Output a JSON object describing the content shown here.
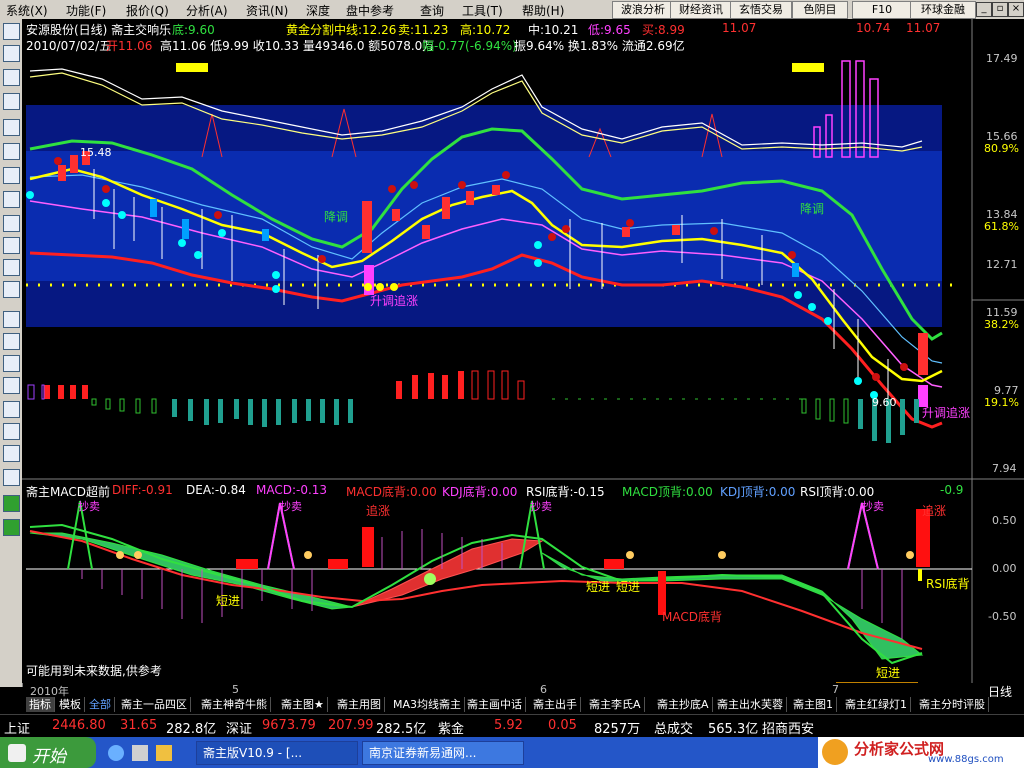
{
  "menubar": {
    "items": [
      "系统(X)",
      "功能(F)",
      "报价(Q)",
      "分析(A)",
      "资讯(N)",
      "深度",
      "盘中参考",
      "查询",
      "工具(T)",
      "帮助(H)"
    ],
    "right_buttons": [
      "波浪分析",
      "财经资讯",
      "玄悟交易",
      "色阴目",
      "F10",
      "环球金融"
    ]
  },
  "header": {
    "stock": "安源股份(日线) 斋主交响乐",
    "bottom": "底:9.60",
    "fib": "黄金分割中线:12.26",
    "sell": "卖:11.23",
    "high": "高:10.72",
    "mid": "中:10.21",
    "low": "低:9.65",
    "buy": "买:8.99",
    "m1": "11.07",
    "m2": "10.74",
    "m3": "11.07",
    "line2_date": "2010/07/02/五",
    "line2_open": "开11.06",
    "line2_rest": "高11.06 低9.99 收10.33 量49346.0 额5078.0万",
    "line2_change": "幅-0.77(-6.94%)",
    "line2_tail": "振9.64% 换1.83% 流通2.69亿"
  },
  "price_axis": {
    "ticks": [
      "17.49",
      "15.66",
      "80.9%",
      "13.84",
      "61.8%",
      "12.71",
      "11.59",
      "38.2%",
      "9.77",
      "19.1%",
      "7.94"
    ]
  },
  "chart_labels": {
    "price_marker": "15.48",
    "low_marker": "9.60",
    "down1": "降调",
    "down2": "降调",
    "up1": "升调追涨",
    "up2": "升调追涨"
  },
  "macd_header": {
    "title": "斋主MACD超前",
    "diff": "DIFF:-0.91",
    "dea": "DEA:-0.84",
    "macd": "MACD:-0.13",
    "m_bottom": "MACD底背:0.00",
    "k_bottom": "KDJ底背:0.00",
    "r_bottom": "RSI底背:-0.15",
    "m_top": "MACD顶背:0.00",
    "k_top": "KDJ顶背:0.00",
    "r_top": "RSI顶背:0.00",
    "tail": "-0.9"
  },
  "macd_axis": {
    "ticks": [
      "0.50",
      "0.00",
      "-0.50"
    ]
  },
  "macd_labels": {
    "sell1": "抄卖",
    "sell2": "抄卖",
    "sell3": "抄卖",
    "sell4": "抄卖",
    "chase1": "追涨",
    "chase2": "追涨",
    "short1": "短进",
    "short2": "短进",
    "short3": "短进",
    "short4": "短进",
    "mbottom": "MACD底背",
    "rbottom": "RSI底背",
    "note": "可能用到未来数据,供参考"
  },
  "date_axis": {
    "labels": [
      "2010年",
      "5",
      "6",
      "7"
    ],
    "current": "2010/07/02/五",
    "period": "日线"
  },
  "tabs": [
    "指标",
    "模板",
    "全部",
    "斋主一品四区",
    "斋主神奇牛熊",
    "斋主图★",
    "斋主用图",
    "MA3均线斋主",
    "斋主画中话",
    "斋主出手",
    "斋主李氏A",
    "斋主抄底A",
    "斋主出水芙蓉",
    "斋主图1",
    "斋主红绿灯1",
    "斋主分时评股"
  ],
  "status": {
    "sh_label": "上证",
    "sh_value": "2446.80",
    "sh_change": "31.65",
    "sh_amount": "282.8亿",
    "sz_label": "深证",
    "sz_value": "9673.79",
    "sz_change": "207.99",
    "sz_amount": "282.5亿",
    "z_label": "紫金",
    "z_value": "5.92",
    "z_change": "0.05",
    "z_amount": "8257万",
    "t_label": "总成交",
    "t_value": "565.3亿",
    "t_broker": "招商西安"
  },
  "taskbar": {
    "start": "开始",
    "tasks": [
      "斋主版V10.9 - [...",
      "南京证券新易通网..."
    ],
    "brand": "分析家公式网",
    "url": "www.88gs.com"
  },
  "colors": {
    "up": "#ff3030",
    "down": "#30c8a8",
    "yellow": "#ffff00",
    "cyan": "#00ffff",
    "magenta": "#ff40ff",
    "green": "#30e040",
    "bandbg": "#0a1e8c"
  }
}
